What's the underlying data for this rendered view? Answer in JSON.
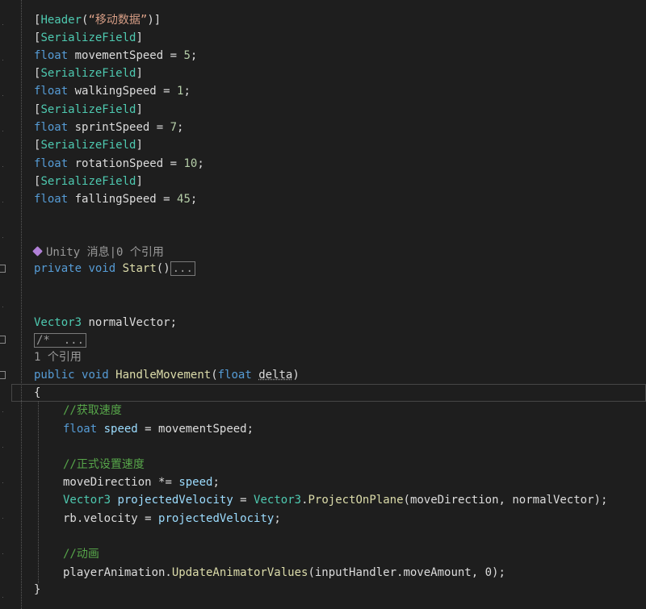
{
  "code": {
    "header_open": "[",
    "header_attr": "Header",
    "header_paren_open": "(",
    "header_string": "“移动数据”",
    "header_paren_close": ")",
    "header_close": "]",
    "serialize_field": "SerializeField",
    "float_kw": "float",
    "fields": [
      {
        "name": " movementSpeed = ",
        "value": "5"
      },
      {
        "name": " walkingSpeed = ",
        "value": "1"
      },
      {
        "name": " sprintSpeed = ",
        "value": "7"
      },
      {
        "name": " rotationSpeed = ",
        "value": "10"
      },
      {
        "name": " fallingSpeed = ",
        "value": "45"
      }
    ],
    "semicolon": ";",
    "start_lens": "Unity 消息|0 个引用",
    "private_kw": "private",
    "void_kw": "void",
    "start_fn": "Start",
    "start_parens": "()",
    "collapsed_ellipsis": "...",
    "vector3_type": "Vector3",
    "normal_vector_decl": " normalVector;",
    "collapsed_comment": "/*  ...",
    "handle_lens": "1 个引用",
    "public_kw": "public",
    "handle_fn": "HandleMovement",
    "handle_param_open": "(",
    "handle_param_type": "float",
    "handle_param_name": "delta",
    "handle_param_close": ")",
    "open_brace": "{",
    "close_brace": "}",
    "comment_get_speed": "//获取速度",
    "speed_var": "speed",
    "speed_assign_rest": " = movementSpeed;",
    "comment_set_speed": "//正式设置速度",
    "move_dir": "moveDirection ",
    "mul_assign": "*=",
    "projected_var": "projectedVelocity",
    "project_call": "ProjectOnPlane",
    "project_args": "(moveDirection, normalVector);",
    "rb_velocity": "rb.velocity = ",
    "comment_anim": "//动画",
    "player_anim": "playerAnimation.",
    "update_fn": "UpdateAnimatorValues",
    "update_args": "(inputHandler.moveAmount, 0);"
  }
}
